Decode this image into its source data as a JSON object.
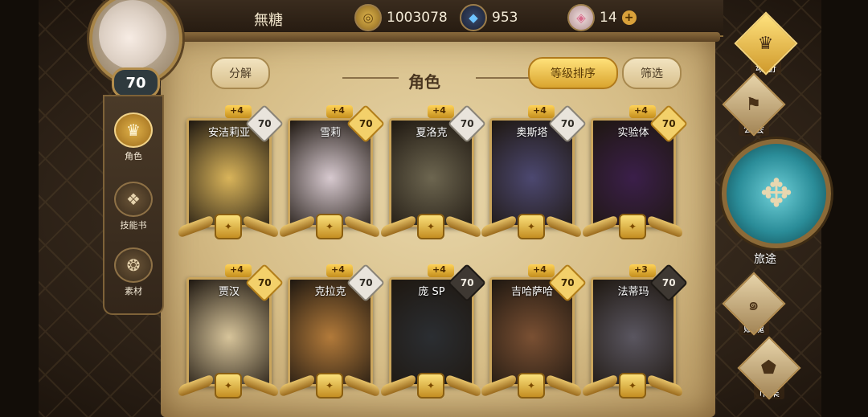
{
  "player": {
    "name": "無糖",
    "level": "70"
  },
  "resources": {
    "gold": {
      "icon": "gold-coin-icon",
      "value": "1003078"
    },
    "crystal": {
      "icon": "blue-crystal-icon",
      "value": "953"
    },
    "gem": {
      "icon": "pink-gem-icon",
      "value": "14"
    }
  },
  "left_nav": [
    {
      "label": "角色",
      "icon": "character-icon",
      "active": true
    },
    {
      "label": "技能书",
      "icon": "skill-book-icon",
      "active": false
    },
    {
      "label": "素材",
      "icon": "material-icon",
      "active": false
    }
  ],
  "header": {
    "decompose": "分解",
    "title": "角色",
    "sort": "等级排序",
    "filter": "筛选"
  },
  "characters": [
    {
      "name": "安洁莉亚",
      "plus": "+4",
      "level": "70",
      "level_style": "silver",
      "tone": "#d9b45a"
    },
    {
      "name": "雪莉",
      "plus": "+4",
      "level": "70",
      "level_style": "gold",
      "tone": "#d7c9cf"
    },
    {
      "name": "夏洛克",
      "plus": "+4",
      "level": "70",
      "level_style": "silver",
      "tone": "#6d6650"
    },
    {
      "name": "奥斯塔",
      "plus": "+4",
      "level": "70",
      "level_style": "silver",
      "tone": "#4c4870"
    },
    {
      "name": "实验体",
      "plus": "+4",
      "level": "70",
      "level_style": "gold",
      "tone": "#3b1f4a"
    },
    {
      "name": "贾汉",
      "plus": "+4",
      "level": "70",
      "level_style": "gold",
      "tone": "#d7c49a"
    },
    {
      "name": "克拉克",
      "plus": "+4",
      "level": "70",
      "level_style": "silver",
      "tone": "#b27a3a"
    },
    {
      "name": "庞 SP",
      "plus": "+4",
      "level": "70",
      "level_style": "dark",
      "tone": "#2b2e32"
    },
    {
      "name": "吉哈萨哈",
      "plus": "+4",
      "level": "70",
      "level_style": "gold",
      "tone": "#7a5033"
    },
    {
      "name": "法蒂玛",
      "plus": "+3",
      "level": "70",
      "level_style": "dark",
      "tone": "#5a5660"
    }
  ],
  "right_menu": {
    "soul_book": "魂册",
    "guild": "公会",
    "journey": "旅途",
    "fu_hun": "赋魂",
    "market": "市集"
  },
  "colors": {
    "accent_gold": "#e0b24a",
    "parchment": "#e0cca0",
    "journey_teal": "#2a8c98"
  }
}
